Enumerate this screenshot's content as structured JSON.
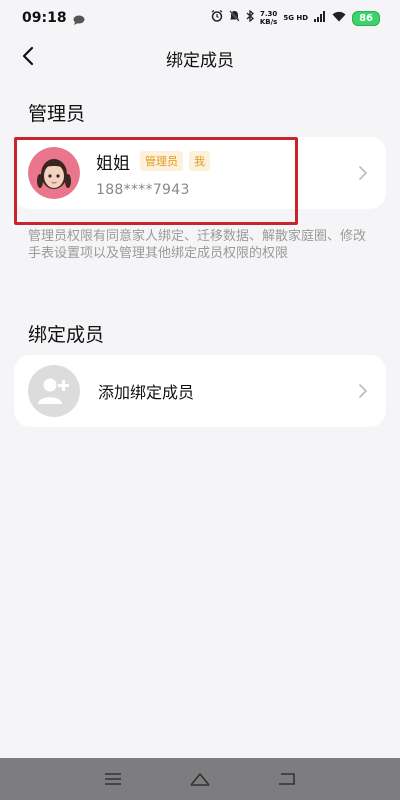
{
  "status_bar": {
    "time": "09:18",
    "net_speed_value": "7.30",
    "net_speed_unit": "KB/s",
    "net_label": "5G HD",
    "battery": "86"
  },
  "header": {
    "title": "绑定成员"
  },
  "admin_section": {
    "title": "管理员",
    "member": {
      "name": "姐姐",
      "badge_admin": "管理员",
      "badge_me": "我",
      "phone": "188****7943"
    },
    "description": "管理员权限有同意家人绑定、迁移数据、解散家庭圈、修改手表设置项以及管理其他绑定成员权限的权限"
  },
  "bound_section": {
    "title": "绑定成员",
    "add_label": "添加绑定成员"
  },
  "colors": {
    "accent_badge": "#e09a1e",
    "highlight": "#c8242b",
    "battery": "#3bd36b"
  },
  "icons": [
    "message-icon",
    "alarm-icon",
    "mute-icon",
    "bluetooth-icon",
    "wifi-icon",
    "back-arrow-icon",
    "chevron-right-icon",
    "add-user-icon",
    "menu-icon",
    "home-icon",
    "return-icon"
  ]
}
